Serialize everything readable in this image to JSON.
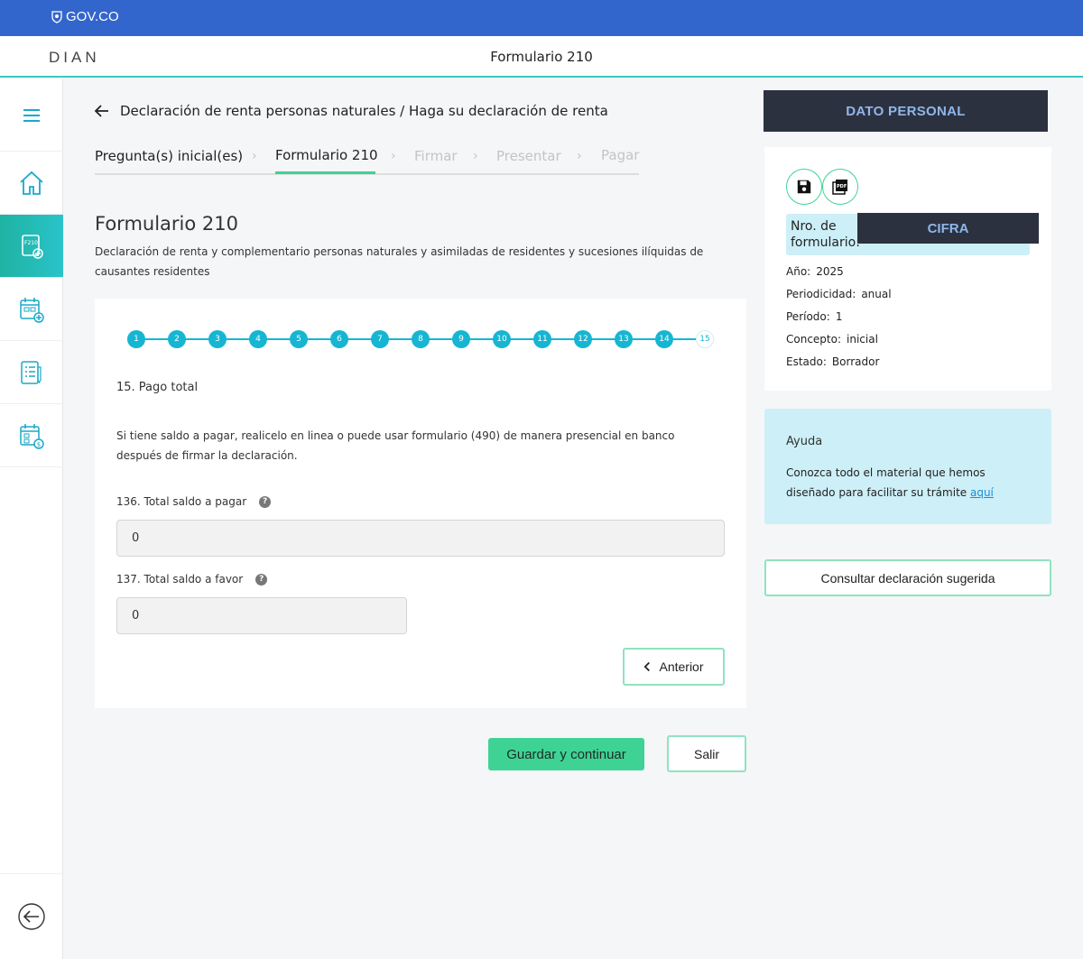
{
  "gov": {
    "logo_text": "GOV.CO"
  },
  "header": {
    "brand": "DIAN",
    "title": "Formulario 210"
  },
  "breadcrumb": {
    "text": "Declaración de renta personas naturales / Haga su declaración de renta"
  },
  "steps": [
    {
      "label": "Pregunta(s) inicial(es)",
      "state": "done"
    },
    {
      "label": "Formulario 210",
      "state": "current"
    },
    {
      "label": "Firmar",
      "state": "off"
    },
    {
      "label": "Presentar",
      "state": "off"
    },
    {
      "label": "Pagar",
      "state": "off"
    }
  ],
  "form": {
    "title": "Formulario 210",
    "subtitle": "Declaración de renta y complementario personas naturales y asimiladas de residentes y sucesiones ilíquidas de causantes residentes"
  },
  "progress": {
    "dots": [
      "1",
      "2",
      "3",
      "4",
      "5",
      "6",
      "7",
      "8",
      "9",
      "10",
      "11",
      "12",
      "13",
      "14",
      "15"
    ],
    "current": 15
  },
  "question": {
    "title": "15. Pago total",
    "description": "Si tiene saldo a pagar, realicelo en linea o puede usar formulario (490) de manera presencial en banco después de firmar la declaración.",
    "fields": [
      {
        "label": "136. Total saldo a pagar",
        "value": "0"
      },
      {
        "label": "137. Total saldo a favor",
        "value": "0"
      }
    ],
    "help_glyph": "?",
    "prev_label": "Anterior"
  },
  "actions": {
    "save_label": "Guardar y continuar",
    "exit_label": "Salir"
  },
  "panel": {
    "header": "DATO PERSONAL",
    "nro_label": "Nro. de formulario:",
    "cifra": "CIFRA",
    "pdf_glyph": "PDF",
    "details": [
      {
        "k": "Año:",
        "v": "2025"
      },
      {
        "k": "Periodicidad:",
        "v": "anual"
      },
      {
        "k": "Período:",
        "v": "1"
      },
      {
        "k": "Concepto:",
        "v": "inicial"
      },
      {
        "k": "Estado:",
        "v": "Borrador"
      }
    ]
  },
  "ayuda": {
    "title": "Ayuda",
    "text": "Conozca todo el material que hemos diseñado para facilitar su trámite",
    "link": "aquí"
  },
  "consult_label": "Consultar declaración sugerida",
  "colors": {
    "gov_blue": "#3366cc",
    "accent_green": "#3ed395",
    "step_blue": "#16b6d2",
    "dark_panel": "#2c3140"
  },
  "sidebar_icons": [
    "menu-icon",
    "home-icon",
    "form-210-icon",
    "calendar-add-icon",
    "checklist-icon",
    "calendar-money-icon",
    "back-circle-icon"
  ]
}
